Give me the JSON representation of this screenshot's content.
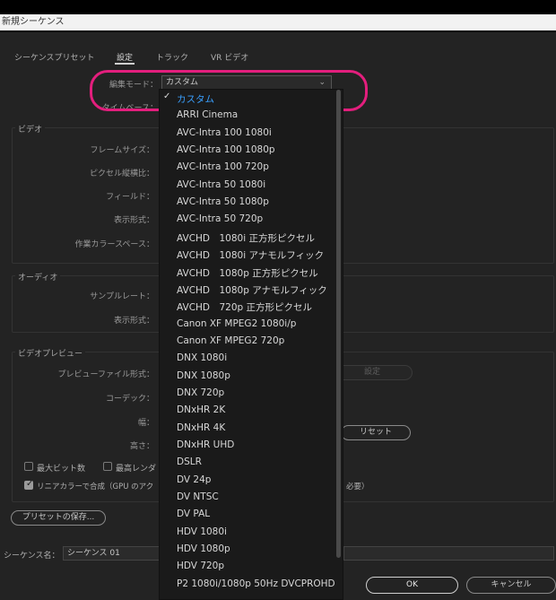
{
  "window": {
    "title": "新規シーケンス"
  },
  "tabs": [
    "シーケンスプリセット",
    "設定",
    "トラック",
    "VR ビデオ"
  ],
  "editing_mode": {
    "label": "編集モード：",
    "value": "カスタム"
  },
  "timebase": {
    "label": "タイムベース："
  },
  "video": {
    "title": "ビデオ",
    "frame_size": "フレームサイズ：",
    "pixel_aspect": "ピクセル縦横比：",
    "field": "フィールド：",
    "display_format": "表示形式：",
    "working_color_space": "作業カラースペース："
  },
  "audio": {
    "title": "オーディオ",
    "sample_rate": "サンプルレート：",
    "display_format": "表示形式："
  },
  "video_preview": {
    "title": "ビデオプレビュー",
    "preview_file_format": "プレビューファイル形式：",
    "settings_button": "設定",
    "codec": "コーデック：",
    "width": "幅：",
    "height": "高さ：",
    "reset_button": "リセット",
    "max_bit_depth": "最大ビット数",
    "max_render_quality": "最高レンダ",
    "linear_color": "リニアカラーで合成（GPU のアク",
    "linear_color_suffix": "必要）"
  },
  "save_preset_button": "プリセットの保存...",
  "sequence_name": {
    "label": "シーケンス名：",
    "value": "シーケンス 01"
  },
  "ok_button": "OK",
  "cancel_button": "キャンセル",
  "dropdown": {
    "check_mark": "✓",
    "items": [
      "カスタム",
      "ARRI Cinema",
      "AVC-Intra 100 1080i",
      "AVC-Intra 100 1080p",
      "AVC-Intra 100 720p",
      "AVC-Intra 50 1080i",
      "AVC-Intra 50 1080p",
      "AVC-Intra 50 720p",
      "AVCHD　1080i 正方形ピクセル",
      "AVCHD　1080i アナモルフィック",
      "AVCHD　1080p 正方形ピクセル",
      "AVCHD　1080p アナモルフィック",
      "AVCHD　720p 正方形ピクセル",
      "Canon XF MPEG2 1080i/p",
      "Canon XF MPEG2 720p",
      "DNX 1080i",
      "DNX 1080p",
      "DNX 720p",
      "DNxHR 2K",
      "DNxHR 4K",
      "DNxHR UHD",
      "DSLR",
      "DV 24p",
      "DV NTSC",
      "DV PAL",
      "HDV 1080i",
      "HDV 1080p",
      "HDV 720p",
      "P2 1080i/1080p 50Hz DVCPROHD"
    ]
  },
  "colors": {
    "highlight": "#e31e7d",
    "selected": "#3aa0ff"
  }
}
